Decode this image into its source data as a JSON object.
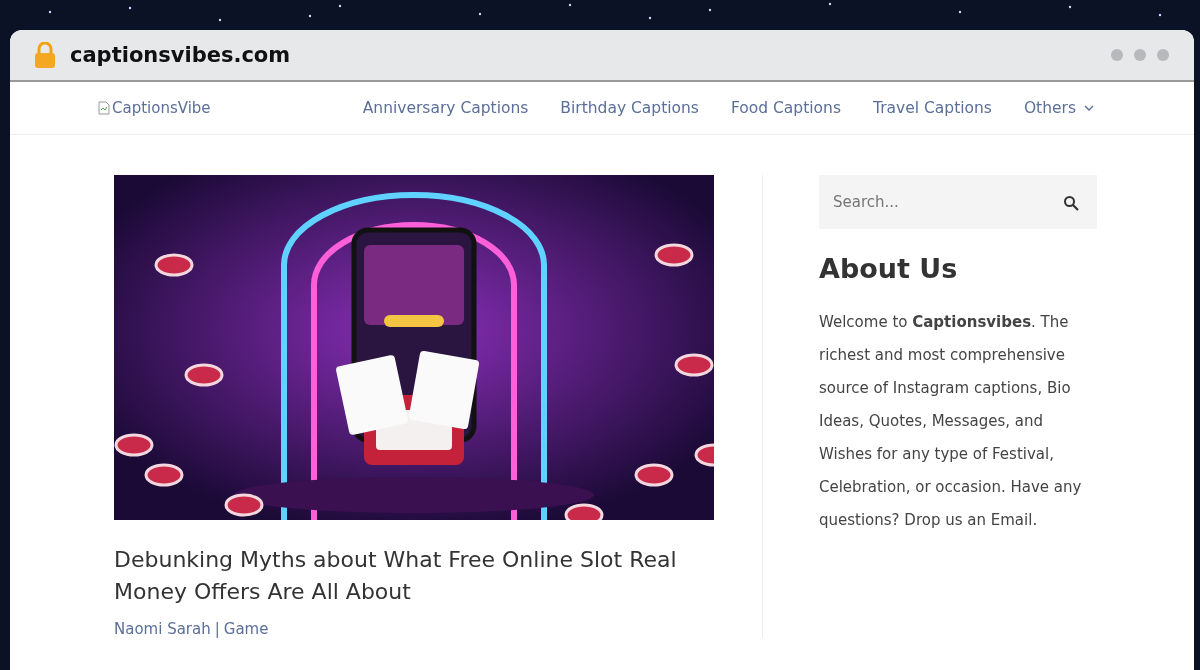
{
  "browser": {
    "url": "captionsvibes.com"
  },
  "header": {
    "logo_alt": "CaptionsVibe",
    "nav": [
      {
        "label": "Anniversary Captions",
        "kind": "link"
      },
      {
        "label": "Birthday Captions",
        "kind": "link"
      },
      {
        "label": "Food Captions",
        "kind": "link"
      },
      {
        "label": "Travel Captions",
        "kind": "link"
      },
      {
        "label": "Others",
        "kind": "dropdown"
      }
    ]
  },
  "article": {
    "title": "Debunking Myths about What Free Online Slot Real Money Offers Are All About",
    "author": "Naomi Sarah",
    "separator": "|",
    "category": "Game"
  },
  "sidebar": {
    "search": {
      "placeholder": "Search..."
    },
    "about_title": "About Us",
    "about_text": "Welcome to **Captionsvibes**. The richest and most comprehensive source of Instagram captions, Bio Ideas, Quotes, Messages, and Wishes for any type of Festival, Celebration, or occasion. Have any questions? Drop us an Email."
  }
}
